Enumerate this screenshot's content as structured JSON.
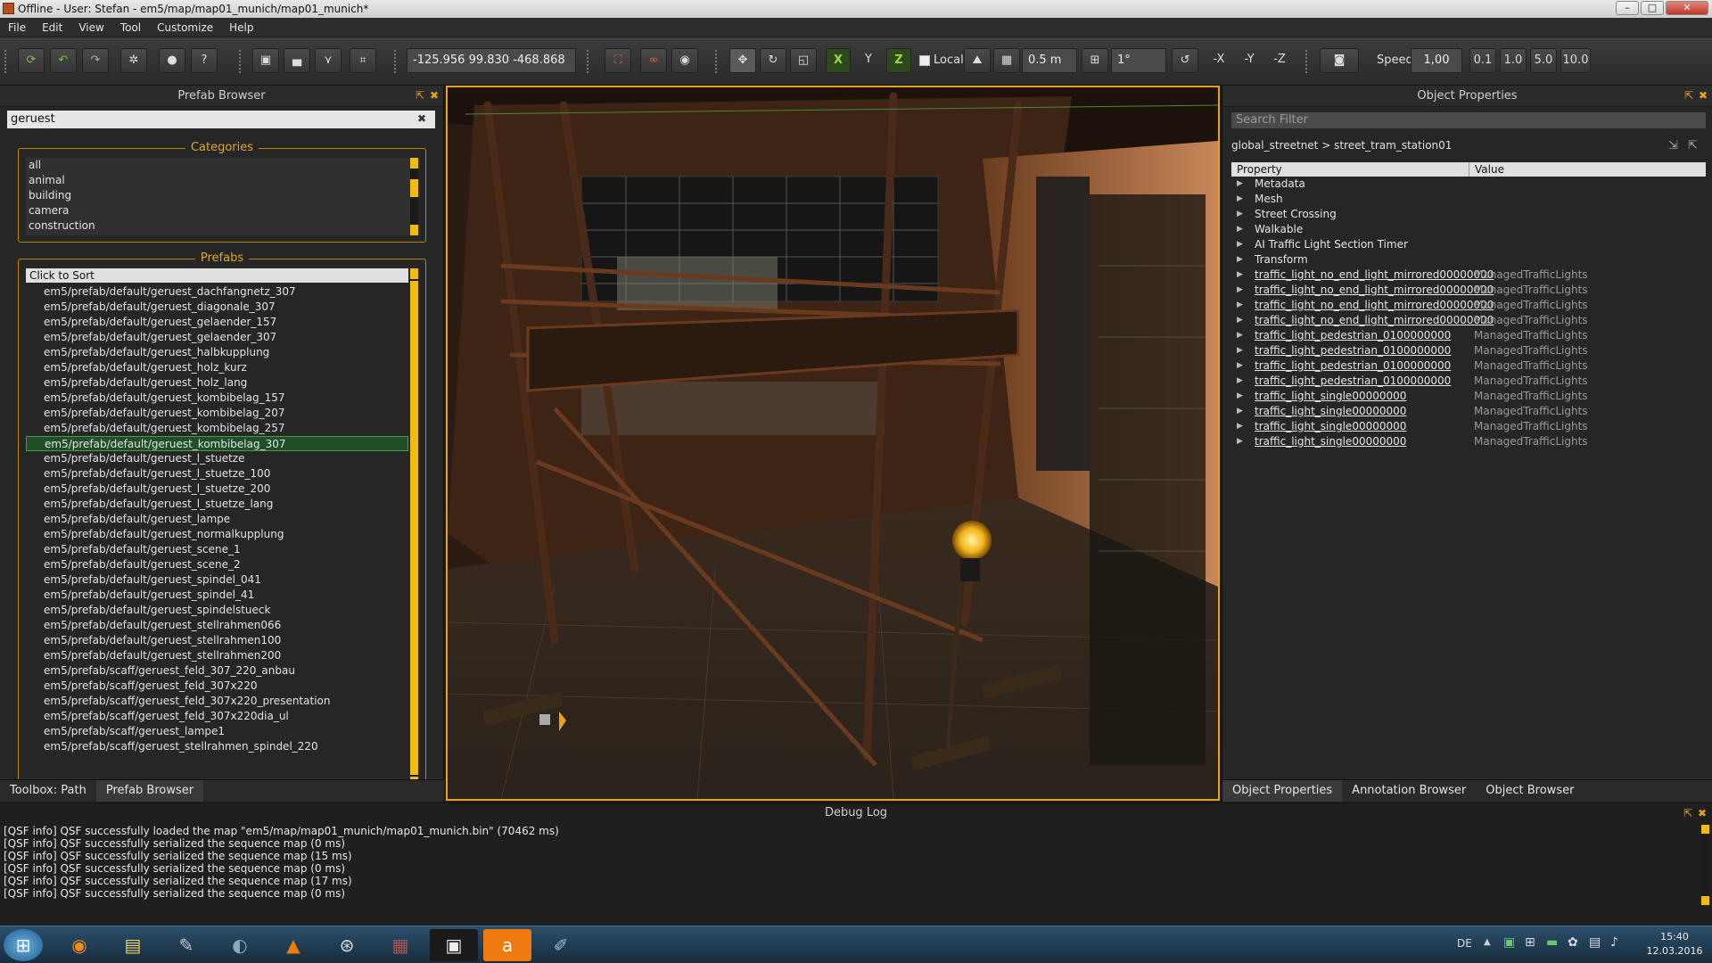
{
  "window": {
    "title": "Offline - User: Stefan - em5/map/map01_munich/map01_munich*"
  },
  "menu": [
    "File",
    "Edit",
    "View",
    "Tool",
    "Customize",
    "Help"
  ],
  "toolbar": {
    "coordinates": "-125.956 99.830 -468.868",
    "axis_x": "X",
    "axis_y": "Y",
    "axis_z": "Z",
    "local_label": "Local",
    "grid_size": "0.5 m",
    "angle": "1°",
    "neg_x": "-X",
    "neg_y": "-Y",
    "neg_z": "-Z",
    "speed_label": "Speed",
    "speed_value": "1,00",
    "speed_presets": [
      "0.1",
      "1.0",
      "5.0",
      "10.0"
    ]
  },
  "prefab_browser": {
    "title": "Prefab Browser",
    "search": "geruest",
    "categories_label": "Categories",
    "categories": [
      "all",
      "animal",
      "building",
      "camera",
      "construction"
    ],
    "prefabs_label": "Prefabs",
    "sort_label": "Click to Sort",
    "selected_index": 10,
    "prefabs": [
      "em5/prefab/default/geruest_dachfangnetz_307",
      "em5/prefab/default/geruest_diagonale_307",
      "em5/prefab/default/geruest_gelaender_157",
      "em5/prefab/default/geruest_gelaender_307",
      "em5/prefab/default/geruest_halbkupplung",
      "em5/prefab/default/geruest_holz_kurz",
      "em5/prefab/default/geruest_holz_lang",
      "em5/prefab/default/geruest_kombibelag_157",
      "em5/prefab/default/geruest_kombibelag_207",
      "em5/prefab/default/geruest_kombibelag_257",
      "em5/prefab/default/geruest_kombibelag_307",
      "em5/prefab/default/geruest_l_stuetze",
      "em5/prefab/default/geruest_l_stuetze_100",
      "em5/prefab/default/geruest_l_stuetze_200",
      "em5/prefab/default/geruest_l_stuetze_lang",
      "em5/prefab/default/geruest_lampe",
      "em5/prefab/default/geruest_normalkupplung",
      "em5/prefab/default/geruest_scene_1",
      "em5/prefab/default/geruest_scene_2",
      "em5/prefab/default/geruest_spindel_041",
      "em5/prefab/default/geruest_spindel_41",
      "em5/prefab/default/geruest_spindelstueck",
      "em5/prefab/default/geruest_stellrahmen066",
      "em5/prefab/default/geruest_stellrahmen100",
      "em5/prefab/default/geruest_stellrahmen200",
      "em5/prefab/scaff/geruest_feld_307_220_anbau",
      "em5/prefab/scaff/geruest_feld_307x220",
      "em5/prefab/scaff/geruest_feld_307x220_presentation",
      "em5/prefab/scaff/geruest_feld_307x220dia_ul",
      "em5/prefab/scaff/geruest_lampe1",
      "em5/prefab/scaff/geruest_stellrahmen_spindel_220"
    ],
    "tabs": [
      "Toolbox: Path",
      "Prefab Browser"
    ]
  },
  "object_properties": {
    "title": "Object Properties",
    "search_placeholder": "Search Filter",
    "breadcrumb": "global_streetnet > street_tram_station01",
    "col_property": "Property",
    "col_value": "Value",
    "groups": [
      "Metadata",
      "Mesh",
      "Street Crossing",
      "Walkable",
      "AI Traffic Light Section Timer",
      "Transform"
    ],
    "items": [
      {
        "name": "traffic_light_no_end_light_mirrored00000000",
        "value": "ManagedTrafficLights"
      },
      {
        "name": "traffic_light_no_end_light_mirrored00000000",
        "value": "ManagedTrafficLights"
      },
      {
        "name": "traffic_light_no_end_light_mirrored00000000",
        "value": "ManagedTrafficLights"
      },
      {
        "name": "traffic_light_no_end_light_mirrored00000000",
        "value": "ManagedTrafficLights"
      },
      {
        "name": "traffic_light_pedestrian_0100000000",
        "value": "ManagedTrafficLights"
      },
      {
        "name": "traffic_light_pedestrian_0100000000",
        "value": "ManagedTrafficLights"
      },
      {
        "name": "traffic_light_pedestrian_0100000000",
        "value": "ManagedTrafficLights"
      },
      {
        "name": "traffic_light_pedestrian_0100000000",
        "value": "ManagedTrafficLights"
      },
      {
        "name": "traffic_light_single00000000",
        "value": "ManagedTrafficLights"
      },
      {
        "name": "traffic_light_single00000000",
        "value": "ManagedTrafficLights"
      },
      {
        "name": "traffic_light_single00000000",
        "value": "ManagedTrafficLights"
      },
      {
        "name": "traffic_light_single00000000",
        "value": "ManagedTrafficLights"
      }
    ],
    "tabs": [
      "Object Properties",
      "Annotation Browser",
      "Object Browser"
    ]
  },
  "debug_log": {
    "title": "Debug Log",
    "lines": [
      "[QSF info] QSF successfully loaded the map \"em5/map/map01_munich/map01_munich.bin\" (70462 ms)",
      "[QSF info] QSF successfully serialized the sequence map (0 ms)",
      "[QSF info] QSF successfully serialized the sequence map (15 ms)",
      "[QSF info] QSF successfully serialized the sequence map (0 ms)",
      "[QSF info] QSF successfully serialized the sequence map (17 ms)",
      "[QSF info] QSF successfully serialized the sequence map (0 ms)"
    ]
  },
  "taskbar": {
    "language": "DE",
    "time": "15:40",
    "date": "12.03.2016"
  },
  "colors": {
    "accent": "#e8a21a",
    "selection": "#204f2a",
    "axis": "#9ed63c"
  }
}
